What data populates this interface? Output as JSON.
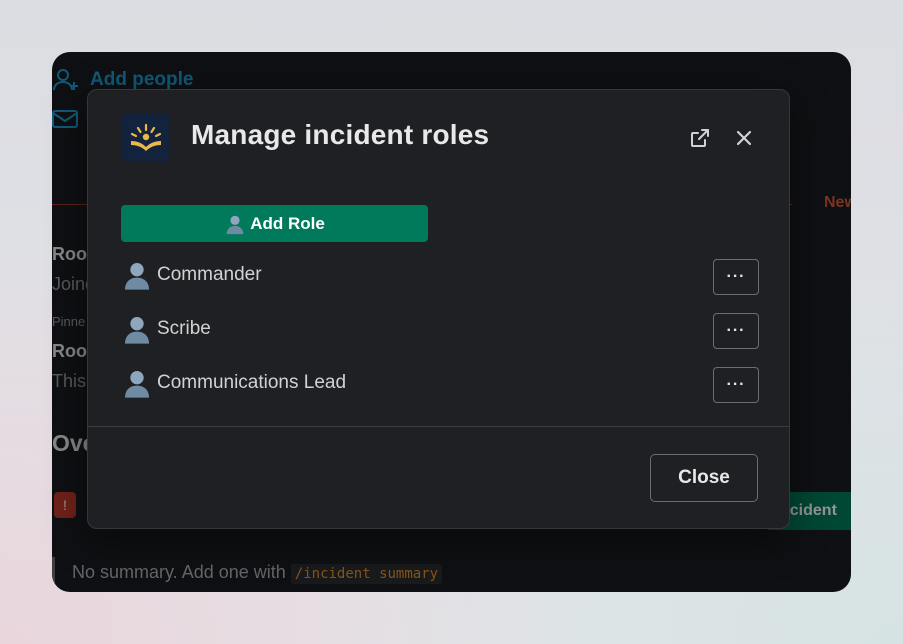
{
  "background": {
    "add_people_label": "Add people",
    "new_label": "New",
    "line1": "Root",
    "line2": "Joine",
    "pinned_label": "Pinne",
    "line3": "Roo",
    "line4": "This",
    "section_heading": "Ove",
    "incident_button_label": "ncident",
    "summary_text": "No summary. Add one with",
    "summary_command": "/incident summary"
  },
  "modal": {
    "title": "Manage incident roles",
    "add_role_label": "Add Role",
    "roles": [
      {
        "name": "Commander"
      },
      {
        "name": "Scribe"
      },
      {
        "name": "Communications Lead"
      }
    ],
    "more_label": "···",
    "close_label": "Close"
  },
  "colors": {
    "accent_green": "#007a5a",
    "modal_bg": "#1f2023",
    "app_icon_bg": "#14233d",
    "app_icon_gold": "#e8b84a"
  }
}
